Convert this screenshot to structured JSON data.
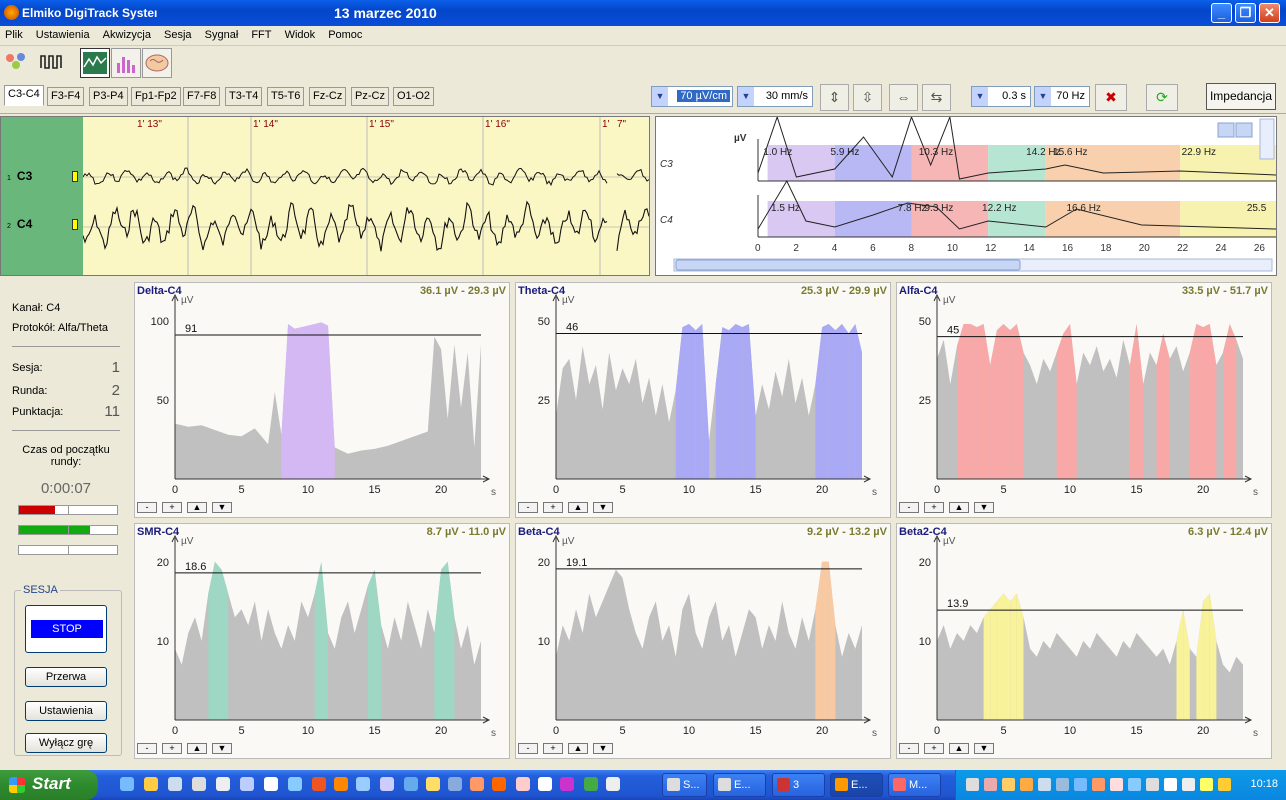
{
  "window": {
    "app_title": "Elmiko DigiTrack Systeı",
    "date": "13 marzec 2010"
  },
  "menu": [
    "Plik",
    "Ustawienia",
    "Akwizycja",
    "Sesja",
    "Sygnał",
    "FFT",
    "Widok",
    "Pomoc"
  ],
  "tabs": [
    "C3-C4",
    "F3-F4",
    "P3-P4",
    "Fp1-Fp2",
    "F7-F8",
    "T3-T4",
    "T5-T6",
    "Fz-Cz",
    "Pz-Cz",
    "O1-O2"
  ],
  "controls": {
    "sensitivity": "70 µV/cm",
    "speed": "30 mm/s",
    "time_const": "0.3 s",
    "hf_filter": "70 Hz",
    "impedance_label": "Impedancja"
  },
  "eeg": {
    "channels": [
      {
        "num": "1",
        "name": "C3"
      },
      {
        "num": "2",
        "name": "C4"
      }
    ],
    "time_marks": [
      "1' 13\"",
      "1' 14\"",
      "1' 15\"",
      "1' 16\"",
      "1'",
      "7\""
    ]
  },
  "spectrum": {
    "unit": "µV",
    "rows": [
      {
        "label": "C3",
        "freqs": [
          "1.0 Hz",
          "5.9 Hz",
          "10.3 Hz",
          "14.2 Hz",
          "15.6 Hz",
          "22.9 Hz"
        ]
      },
      {
        "label": "C4",
        "freqs": [
          "1.5 Hz",
          "7.8 Hz",
          "9.3 Hz",
          "12.2 Hz",
          "16.6 Hz",
          "25.5"
        ]
      }
    ],
    "xticks": [
      "0",
      "2",
      "4",
      "6",
      "8",
      "10",
      "12",
      "14",
      "16",
      "18",
      "20",
      "22",
      "24",
      "26"
    ],
    "bands": [
      {
        "from": 0.5,
        "to": 4,
        "color": "#d8c8f2"
      },
      {
        "from": 4,
        "to": 8,
        "color": "#b8b8f5"
      },
      {
        "from": 8,
        "to": 12,
        "color": "#f7b6b6"
      },
      {
        "from": 12,
        "to": 15,
        "color": "#b6e6d2"
      },
      {
        "from": 15,
        "to": 22,
        "color": "#f9d0ad"
      },
      {
        "from": 22,
        "to": 27,
        "color": "#f7f2b0"
      }
    ]
  },
  "sidebar": {
    "channel": "Kanał: C4",
    "protocol": "Protokół: Alfa/Theta",
    "session_label": "Sesja:",
    "session": "1",
    "round_label": "Runda:",
    "round": "2",
    "points_label": "Punktacja:",
    "points": "11",
    "time_label": "Czas od początku rundy:",
    "time": "0:00:07",
    "bars": [
      0.37,
      0.72,
      0.0
    ],
    "group_label": "SESJA",
    "stop": "STOP",
    "pause": "Przerwa",
    "settings": "Ustawienia",
    "off": "Wyłącz grę"
  },
  "chart_data": [
    {
      "type": "area",
      "title": "Delta-C4",
      "value_text": "36.1 µV - 29.3 µV",
      "ylabel": "µV",
      "xlabel": "s",
      "ylim": [
        0,
        110
      ],
      "yticks": [
        50,
        100
      ],
      "xlim": [
        0,
        23
      ],
      "xticks": [
        0,
        5,
        10,
        15,
        20
      ],
      "threshold": 91,
      "color": "#d4b8f4",
      "x": [
        0,
        1,
        2,
        3,
        4,
        5,
        6,
        7,
        7.5,
        8,
        8.5,
        9,
        10,
        11,
        11.5,
        12,
        13,
        14,
        15,
        16,
        17,
        18,
        19,
        19.5,
        20,
        20.5,
        21,
        21.5,
        22,
        22.5,
        23
      ],
      "values": [
        35,
        33,
        34,
        31,
        28,
        27,
        32,
        22,
        55,
        28,
        98,
        95,
        97,
        99,
        97,
        20,
        16,
        18,
        19,
        21,
        24,
        27,
        30,
        90,
        82,
        38,
        85,
        45,
        80,
        20,
        85
      ]
    },
    {
      "type": "area",
      "title": "Theta-C4",
      "value_text": "25.3 µV - 29.9 µV",
      "ylabel": "µV",
      "xlabel": "s",
      "ylim": [
        0,
        55
      ],
      "yticks": [
        25,
        50
      ],
      "xlim": [
        0,
        23
      ],
      "xticks": [
        0,
        5,
        10,
        15,
        20
      ],
      "threshold": 46,
      "color": "#a9a9f5",
      "x": [
        0,
        0.5,
        1,
        1.5,
        2,
        2.5,
        3,
        3.5,
        4,
        4.5,
        5,
        5.5,
        6,
        6.5,
        7,
        7.5,
        8,
        8.5,
        9,
        9.5,
        10,
        10.5,
        11,
        11.5,
        12,
        12.5,
        13,
        13.5,
        14,
        14.5,
        15,
        15.5,
        16,
        16.5,
        17,
        17.5,
        18,
        18.5,
        19,
        19.5,
        20,
        20.5,
        21,
        21.5,
        22,
        22.5,
        23
      ],
      "values": [
        20,
        35,
        38,
        25,
        42,
        30,
        36,
        22,
        40,
        28,
        35,
        30,
        38,
        24,
        32,
        20,
        30,
        18,
        28,
        48,
        49,
        47,
        49,
        12,
        30,
        48,
        47,
        49,
        48,
        49,
        20,
        30,
        22,
        34,
        26,
        38,
        24,
        32,
        20,
        30,
        48,
        49,
        47,
        49,
        46,
        49,
        40
      ]
    },
    {
      "type": "area",
      "title": "Alfa-C4",
      "value_text": "33.5 µV - 51.7 µV",
      "ylabel": "µV",
      "xlabel": "s",
      "ylim": [
        0,
        55
      ],
      "yticks": [
        25,
        50
      ],
      "xlim": [
        0,
        23
      ],
      "xticks": [
        0,
        5,
        10,
        15,
        20
      ],
      "threshold": 45,
      "color": "#f9a8a8",
      "x": [
        0,
        0.5,
        1,
        1.5,
        2,
        2.5,
        3,
        3.5,
        4,
        4.5,
        5,
        5.5,
        6,
        6.5,
        7,
        7.5,
        8,
        8.5,
        9,
        9.5,
        10,
        10.5,
        11,
        11.5,
        12,
        12.5,
        13,
        13.5,
        14,
        14.5,
        15,
        15.5,
        16,
        16.5,
        17,
        17.5,
        18,
        18.5,
        19,
        19.5,
        20,
        20.5,
        21,
        21.5,
        22,
        22.5,
        23
      ],
      "values": [
        38,
        44,
        30,
        42,
        49,
        49,
        48,
        49,
        36,
        47,
        49,
        47,
        49,
        40,
        36,
        30,
        38,
        34,
        40,
        46,
        49,
        30,
        40,
        36,
        42,
        34,
        38,
        32,
        44,
        36,
        49,
        30,
        40,
        36,
        46,
        38,
        42,
        34,
        40,
        49,
        48,
        49,
        36,
        40,
        49,
        44,
        38
      ]
    },
    {
      "type": "area",
      "title": "SMR-C4",
      "value_text": "8.7 µV - 11.0 µV",
      "ylabel": "µV",
      "xlabel": "s",
      "ylim": [
        0,
        22
      ],
      "yticks": [
        10,
        20
      ],
      "xlim": [
        0,
        23
      ],
      "xticks": [
        0,
        5,
        10,
        15,
        20
      ],
      "threshold": 18.6,
      "color": "#9ed8c4",
      "x": [
        0,
        0.5,
        1,
        1.5,
        2,
        2.5,
        3,
        3.5,
        4,
        4.5,
        5,
        5.5,
        6,
        6.5,
        7,
        7.5,
        8,
        8.5,
        9,
        9.5,
        10,
        10.5,
        11,
        11.5,
        12,
        12.5,
        13,
        13.5,
        14,
        14.5,
        15,
        15.5,
        16,
        16.5,
        17,
        17.5,
        18,
        18.5,
        19,
        19.5,
        20,
        20.5,
        21,
        21.5,
        22,
        22.5,
        23
      ],
      "values": [
        9,
        7,
        11,
        13,
        10,
        16,
        20,
        19,
        16,
        13,
        14,
        12,
        15,
        10,
        14,
        11,
        9,
        12,
        10,
        15,
        13,
        16,
        20,
        11,
        9,
        13,
        15,
        11,
        14,
        17,
        19,
        12,
        9,
        13,
        10,
        15,
        12,
        9,
        14,
        11,
        19,
        20,
        13,
        9,
        12,
        7,
        10
      ]
    },
    {
      "type": "area",
      "title": "Beta-C4",
      "value_text": "9.2 µV - 13.2 µV",
      "ylabel": "µV",
      "xlabel": "s",
      "ylim": [
        0,
        22
      ],
      "yticks": [
        10,
        20
      ],
      "xlim": [
        0,
        23
      ],
      "xticks": [
        0,
        5,
        10,
        15,
        20
      ],
      "threshold": 19.1,
      "color": "#f9c9a2",
      "x": [
        0,
        0.5,
        1,
        1.5,
        2,
        2.5,
        3,
        3.5,
        4,
        4.5,
        5,
        5.5,
        6,
        6.5,
        7,
        7.5,
        8,
        8.5,
        9,
        9.5,
        10,
        10.5,
        11,
        11.5,
        12,
        12.5,
        13,
        13.5,
        14,
        14.5,
        15,
        15.5,
        16,
        16.5,
        17,
        17.5,
        18,
        18.5,
        19,
        19.5,
        20,
        20.5,
        21,
        21.5,
        22,
        22.5,
        23
      ],
      "values": [
        8,
        12,
        10,
        14,
        11,
        16,
        13,
        15,
        17,
        19,
        18,
        14,
        11,
        9,
        13,
        15,
        10,
        12,
        8,
        14,
        16,
        11,
        9,
        13,
        15,
        10,
        12,
        8,
        11,
        14,
        13,
        9,
        12,
        10,
        15,
        11,
        9,
        13,
        10,
        14,
        20,
        20,
        12,
        8,
        11,
        9,
        12
      ]
    },
    {
      "type": "area",
      "title": "Beta2-C4",
      "value_text": "6.3 µV - 12.4 µV",
      "ylabel": "µV",
      "xlabel": "s",
      "ylim": [
        0,
        22
      ],
      "yticks": [
        10,
        20
      ],
      "xlim": [
        0,
        23
      ],
      "xticks": [
        0,
        5,
        10,
        15,
        20
      ],
      "threshold": 13.9,
      "color": "#f8f29a",
      "x": [
        0,
        0.5,
        1,
        1.5,
        2,
        2.5,
        3,
        3.5,
        4,
        4.5,
        5,
        5.5,
        6,
        6.5,
        7,
        7.5,
        8,
        8.5,
        9,
        9.5,
        10,
        10.5,
        11,
        11.5,
        12,
        12.5,
        13,
        13.5,
        14,
        14.5,
        15,
        15.5,
        16,
        16.5,
        17,
        17.5,
        18,
        18.5,
        19,
        19.5,
        20,
        20.5,
        21,
        21.5,
        22,
        22.5,
        23
      ],
      "values": [
        10,
        12,
        9,
        11,
        10,
        12,
        11,
        13,
        14,
        15,
        16,
        15,
        16,
        13,
        9,
        8,
        10,
        9,
        11,
        10,
        9,
        8,
        10,
        9,
        11,
        10,
        9,
        8,
        10,
        9,
        11,
        10,
        9,
        8,
        9,
        7,
        10,
        14,
        9,
        8,
        15,
        16,
        10,
        7,
        6,
        8,
        7
      ]
    }
  ],
  "taskbar": {
    "start": "Start",
    "buttons": [
      {
        "label": "S..."
      },
      {
        "label": "E..."
      },
      {
        "label": "3"
      },
      {
        "label": "E..."
      },
      {
        "label": "M..."
      }
    ],
    "clock": "10:18"
  }
}
